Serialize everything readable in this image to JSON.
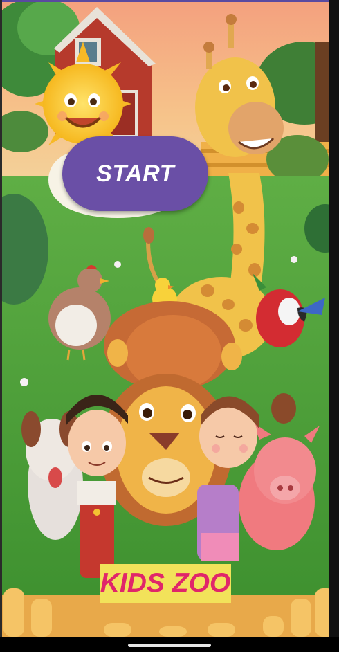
{
  "app": {
    "start_label": "START",
    "title": "KIDS ZOO"
  },
  "illustration": {
    "characters": [
      "sun",
      "giraffe",
      "lion",
      "chick",
      "hen",
      "parrot",
      "dog",
      "pig",
      "boy",
      "girl"
    ],
    "colors": {
      "sky": "#f29a7a",
      "grass": "#4fa63a",
      "button": "#6a4fa6",
      "title_bg": "#f2e25a",
      "title_text": "#e0266a"
    }
  }
}
